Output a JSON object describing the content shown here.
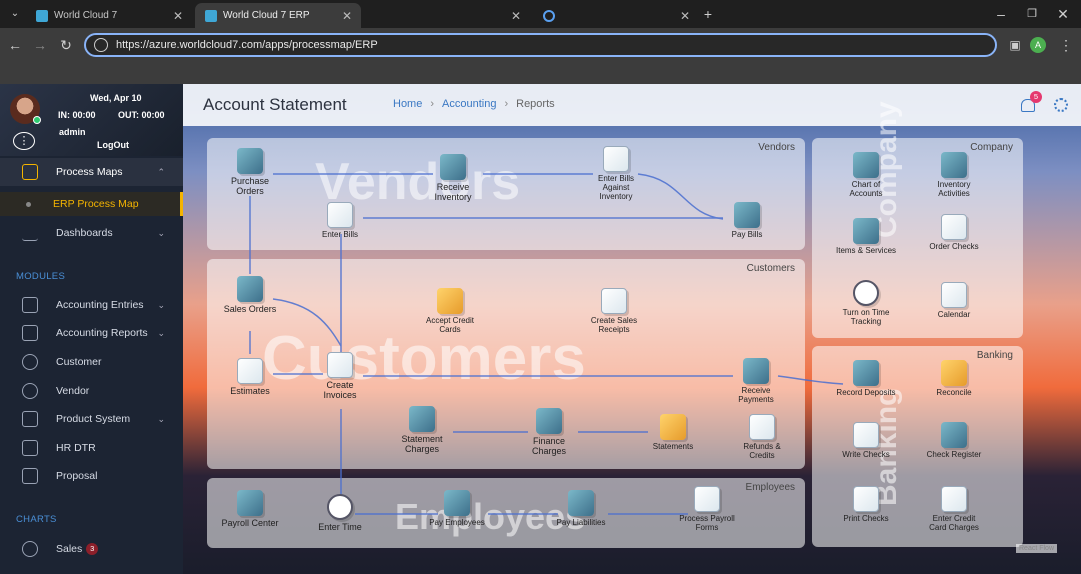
{
  "browser": {
    "tabs": [
      {
        "title": "World Cloud 7",
        "active": false
      },
      {
        "title": "World Cloud 7 ERP",
        "active": true
      },
      {
        "title": "",
        "active": false
      }
    ],
    "url": "https://azure.worldcloud7.com/apps/processmap/ERP",
    "profile_initial": "A"
  },
  "user": {
    "date": "Wed, Apr 10",
    "in_label": "IN: 00:00",
    "out_label": "OUT: 00:00",
    "username": "admin",
    "logout_label": "LogOut"
  },
  "sidebar": {
    "process_maps": "Process Maps",
    "erp_process_map": "ERP Process Map",
    "dashboards": "Dashboards",
    "modules_header": "MODULES",
    "modules": [
      {
        "label": "Accounting Entries",
        "chevron": true
      },
      {
        "label": "Accounting Reports",
        "chevron": true
      },
      {
        "label": "Customer",
        "chevron": false
      },
      {
        "label": "Vendor",
        "chevron": false
      },
      {
        "label": "Product System",
        "chevron": true
      },
      {
        "label": "HR DTR",
        "chevron": false
      },
      {
        "label": "Proposal",
        "chevron": false
      }
    ],
    "charts_header": "CHARTS",
    "sales_label": "Sales",
    "sales_badge": "3"
  },
  "header": {
    "title": "Account Statement",
    "breadcrumb": [
      "Home",
      "Accounting",
      "Reports"
    ],
    "notification_count": "5"
  },
  "groups": {
    "vendors": "Vendors",
    "customers": "Customers",
    "employees": "Employees",
    "company": "Company",
    "banking": "Banking"
  },
  "watermarks": {
    "vendors": "Vendors",
    "customers": "Customers",
    "employees": "Employees",
    "company": "Company",
    "banking": "Banking"
  },
  "nodes": {
    "purchase_orders": "Purchase Orders",
    "receive_inventory": "Receive Inventory",
    "enter_bills_against_inventory": "Enter Bills Against Inventory",
    "enter_bills": "Enter Bills",
    "pay_bills": "Pay Bills",
    "sales_orders": "Sales Orders",
    "accept_credit_cards": "Accept Credit Cards",
    "create_sales_receipts": "Create Sales Receipts",
    "estimates": "Estimates",
    "create_invoices": "Create Invoices",
    "receive_payments": "Receive Payments",
    "statement_charges": "Statement Charges",
    "finance_charges": "Finance Charges",
    "statements": "Statements",
    "refunds_credits": "Refunds & Credits",
    "payroll_center": "Payroll Center",
    "enter_time": "Enter Time",
    "pay_employees": "Pay Employees",
    "pay_liabilities": "Pay Liabilities",
    "process_payroll_forms": "Process Payroll Forms",
    "chart_of_accounts": "Chart of Accounts",
    "inventory_activities": "Inventory Activities",
    "items_services": "Items & Services",
    "order_checks": "Order Checks",
    "turn_on_time_tracking": "Turn on Time Tracking",
    "calendar": "Calendar",
    "record_deposits": "Record Deposits",
    "reconcile": "Reconcile",
    "write_checks": "Write Checks",
    "check_register": "Check Register",
    "print_checks": "Print Checks",
    "enter_credit_card_charges": "Enter Credit Card Charges"
  },
  "react_flow_label": "React Flow"
}
